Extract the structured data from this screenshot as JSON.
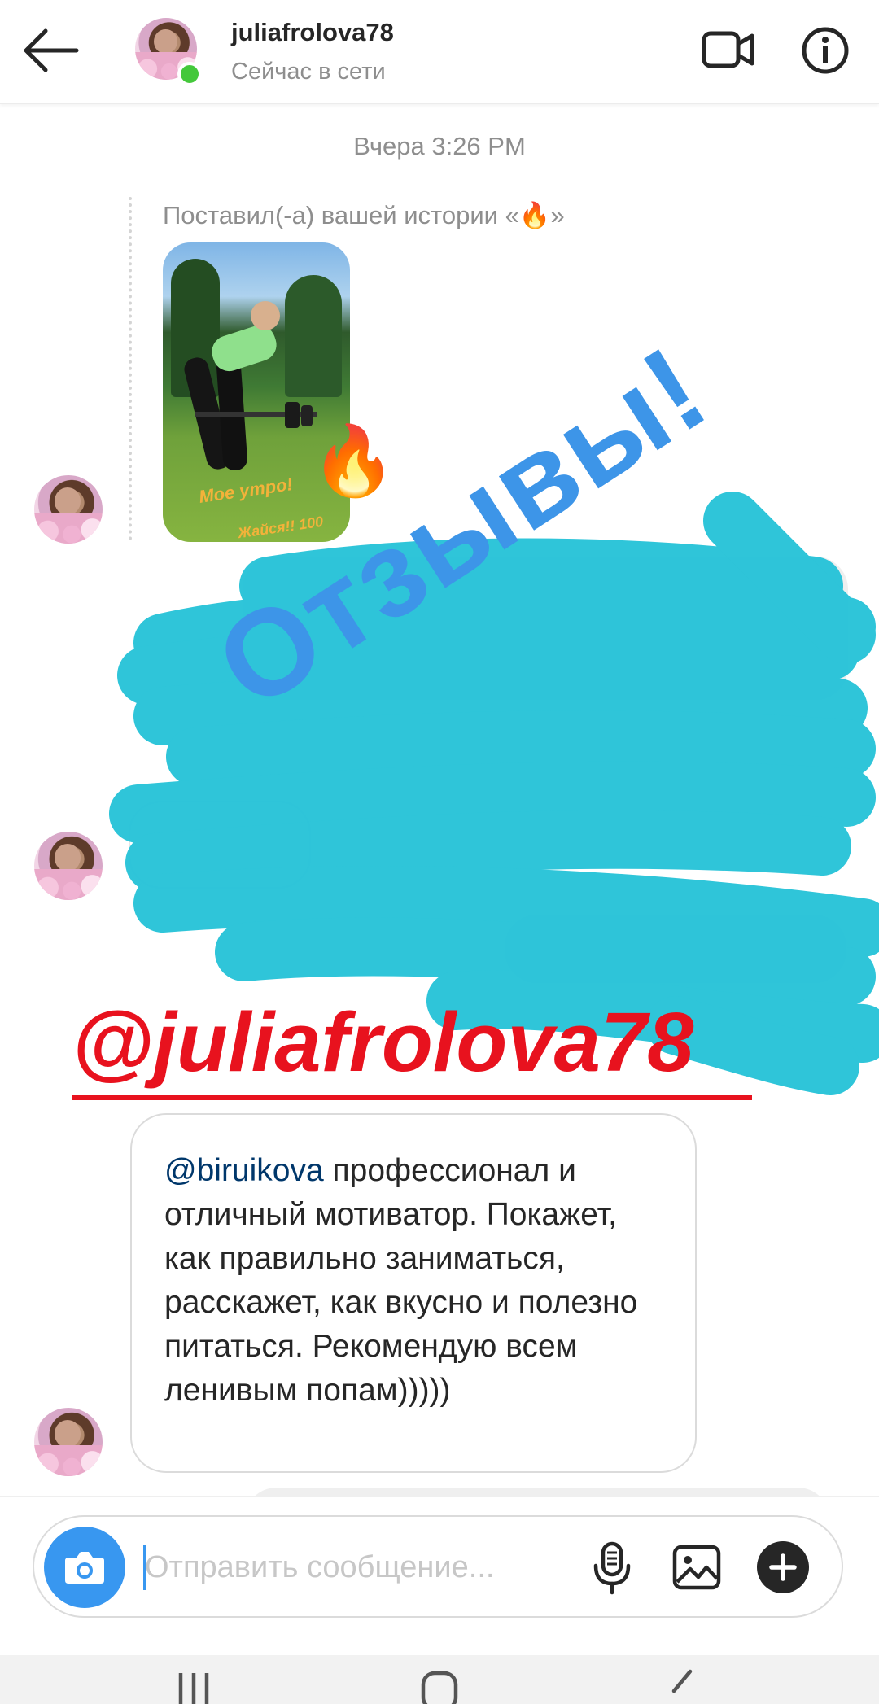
{
  "header": {
    "username": "juliafrolova78",
    "status": "Сейчас в сети"
  },
  "thread": {
    "timestamp": "Вчера 3:26 PM",
    "story_reply_caption": "Поставил(-а) вашей истории «🔥»",
    "story_text_1": "Мое утро!",
    "story_text_2": "Жайся!! 100",
    "reaction_emoji": "🔥",
    "message": {
      "mention": "@biruikova",
      "text": " профессионал и отличный мотиватор. Покажет, как правильно заниматься, расскажет, как вкусно и полезно питаться. Рекомендую всем ленивым попам)))))"
    }
  },
  "overlay": {
    "stamp_text": "Отзывы!",
    "handle_text": "@juliafrolova78",
    "scribble_color": "#2bc4d9",
    "stamp_color": "#3d95e8",
    "handle_color": "#e8121e"
  },
  "composer": {
    "placeholder": "Отправить сообщение..."
  },
  "icons": {
    "back": "arrow-left-icon",
    "video": "video-camera-icon",
    "info": "info-icon",
    "camera": "camera-icon",
    "mic": "microphone-icon",
    "gallery": "gallery-icon",
    "plus": "plus-icon"
  },
  "colors": {
    "accent": "#3897f0",
    "online": "#44c83b",
    "mention": "#00376b"
  }
}
